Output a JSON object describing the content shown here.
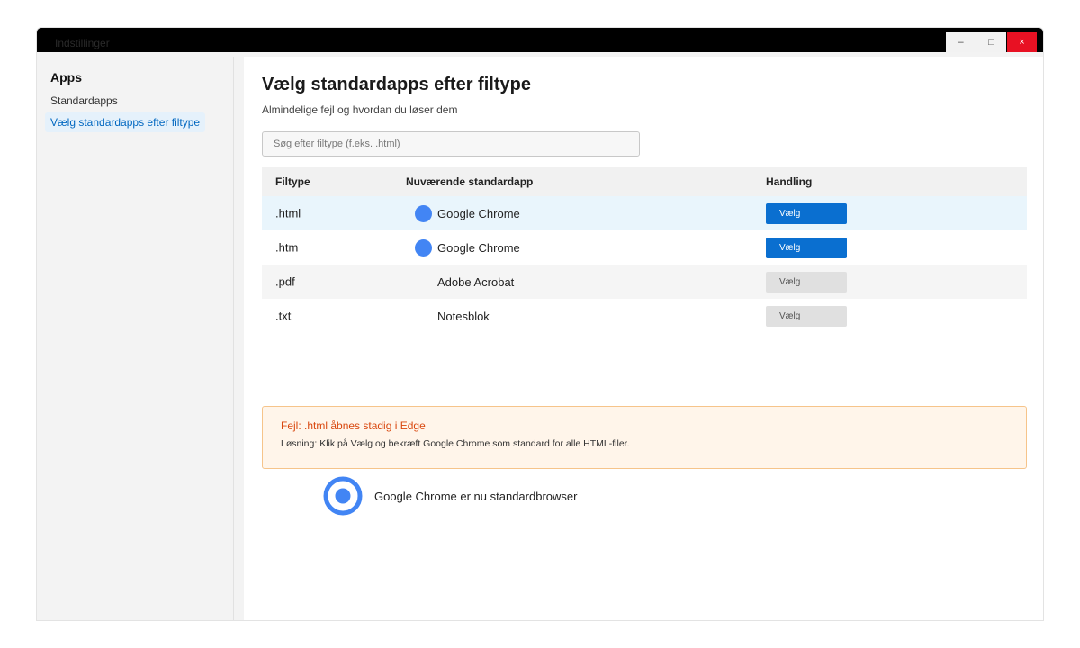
{
  "window": {
    "title": "Indstillinger",
    "min_glyph": "–",
    "max_glyph": "□",
    "close_glyph": "×"
  },
  "sidebar": {
    "title": "Apps",
    "items": [
      {
        "label": "Standardapps"
      },
      {
        "label": "Vælg standardapps efter filtype"
      }
    ]
  },
  "main": {
    "title": "Vælg standardapps efter filtype",
    "subtitle": "Almindelige fejl og hvordan du løser dem",
    "search_placeholder": "Søg efter filtype (f.eks. .html)"
  },
  "table": {
    "headers": [
      "Filtype",
      "Nuværende standardapp",
      "Handling"
    ],
    "rows": [
      {
        "type": ".html",
        "app": "Google Chrome",
        "icon": "chrome-icon",
        "action": "Vælg"
      },
      {
        "type": ".htm",
        "app": "Google Chrome",
        "icon": "chrome-icon",
        "action": "Vælg"
      },
      {
        "type": ".pdf",
        "app": "Adobe Acrobat",
        "icon": "",
        "action": "Vælg"
      },
      {
        "type": ".txt",
        "app": "Notesblok",
        "icon": "",
        "action": "Vælg"
      }
    ]
  },
  "error": {
    "title": "Fejl: .html åbnes stadig i Edge",
    "solution": "Løsning: Klik på Vælg og bekræft Google Chrome som standard for alle HTML-filer."
  },
  "status": {
    "text": "Google Chrome er nu standardbrowser",
    "icon": "radio-selected-icon"
  },
  "colors": {
    "accent": "#0a6fd0",
    "chrome_dot": "#4285f4",
    "error": "#d9480f",
    "close": "#e81123"
  }
}
